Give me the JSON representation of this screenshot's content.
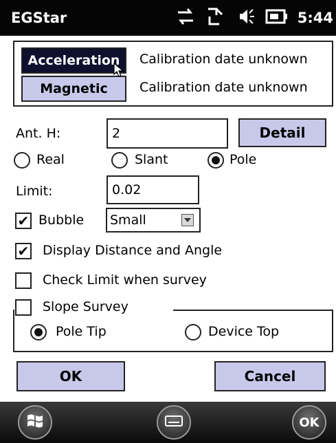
{
  "status_bar": {
    "title": "EGStar",
    "time": "5:44",
    "icons": [
      "connectivity-icon",
      "network-icon",
      "volume-icon",
      "battery-icon"
    ]
  },
  "calibration": {
    "acceleration_label": "Acceleration",
    "acceleration_status": "Calibration date unknown",
    "magnetic_label": "Magnetic",
    "magnetic_status": "Calibration date unknown"
  },
  "antenna": {
    "label": "Ant. H:",
    "value": "2",
    "detail_label": "Detail",
    "modes": [
      {
        "label": "Real",
        "selected": false
      },
      {
        "label": "Slant",
        "selected": false
      },
      {
        "label": "Pole",
        "selected": true
      }
    ]
  },
  "limit": {
    "label": "Limit:",
    "value": "0.02"
  },
  "bubble": {
    "label": "Bubble",
    "checked": true,
    "size_value": "Small"
  },
  "display_distance": {
    "label": "Display Distance and Angle",
    "checked": true
  },
  "check_limit": {
    "label": "Check Limit when survey",
    "checked": false
  },
  "slope_survey": {
    "label": "Slope Survey",
    "checked": false,
    "options": [
      {
        "label": "Pole Tip",
        "selected": true
      },
      {
        "label": "Device Top",
        "selected": false
      }
    ]
  },
  "actions": {
    "ok_label": "OK",
    "cancel_label": "Cancel"
  },
  "taskbar": {
    "ok_label": "OK"
  },
  "colors": {
    "button_bg": "#c8c9ea",
    "active_button_bg": "#0f0f2e",
    "status_bar_bg": "#050505"
  }
}
